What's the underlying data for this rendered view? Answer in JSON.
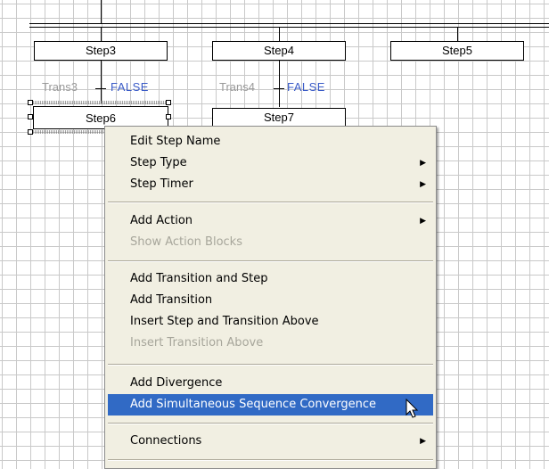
{
  "diagram": {
    "steps": {
      "step3": "Step3",
      "step4": "Step4",
      "step5": "Step5",
      "step6": "Step6",
      "step7": "Step7"
    },
    "transitions": {
      "trans3": {
        "name": "Trans3",
        "value": "FALSE"
      },
      "trans4": {
        "name": "Trans4",
        "value": "FALSE"
      }
    }
  },
  "context_menu": {
    "items": [
      {
        "label": "Edit Step Name",
        "enabled": true,
        "submenu": false
      },
      {
        "label": "Step Type",
        "enabled": true,
        "submenu": true
      },
      {
        "label": "Step Timer",
        "enabled": true,
        "submenu": true
      },
      {
        "label": "Add Action",
        "enabled": true,
        "submenu": true
      },
      {
        "label": "Show Action Blocks",
        "enabled": false,
        "submenu": false
      },
      {
        "label": "Add Transition and Step",
        "enabled": true,
        "submenu": false
      },
      {
        "label": "Add Transition",
        "enabled": true,
        "submenu": false
      },
      {
        "label": "Insert Step and Transition Above",
        "enabled": true,
        "submenu": false
      },
      {
        "label": "Insert Transition Above",
        "enabled": false,
        "submenu": false
      },
      {
        "label": "Add Divergence",
        "enabled": true,
        "submenu": false
      },
      {
        "label": "Add Simultaneous Sequence Convergence",
        "enabled": true,
        "submenu": false,
        "highlighted": true
      },
      {
        "label": "Connections",
        "enabled": true,
        "submenu": true
      }
    ],
    "colors": {
      "highlight": "#316ac5",
      "menu_bg": "#f1efe2",
      "disabled_text": "#a7a69b"
    }
  },
  "colors": {
    "transition_value": "#3a5bc7",
    "transition_label": "#9a9a9a",
    "grid": "#c9c9c9"
  }
}
